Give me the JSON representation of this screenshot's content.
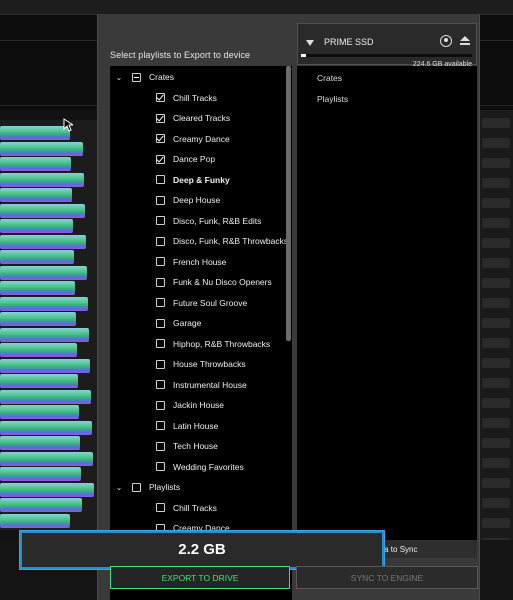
{
  "dialog": {
    "title": "Select playlists to Export to device"
  },
  "device": {
    "name": "PRIME SSD",
    "available": "224.6 GB available",
    "usage_fraction": 0.03
  },
  "tree": [
    {
      "indent": 0,
      "chevron": "v",
      "check": "partial",
      "label": "Crates",
      "bold": false
    },
    {
      "indent": 1,
      "check": "checked",
      "label": "Chill Tracks"
    },
    {
      "indent": 1,
      "check": "checked",
      "label": "Cleared Tracks"
    },
    {
      "indent": 1,
      "check": "checked",
      "label": "Creamy Dance"
    },
    {
      "indent": 1,
      "check": "checked",
      "label": "Dance Pop"
    },
    {
      "indent": 1,
      "check": "unchecked",
      "label": "Deep & Funky",
      "bold": true
    },
    {
      "indent": 1,
      "check": "unchecked",
      "label": "Deep House"
    },
    {
      "indent": 1,
      "check": "unchecked",
      "label": "Disco, Funk, R&B Edits"
    },
    {
      "indent": 1,
      "check": "unchecked",
      "label": "Disco, Funk, R&B Throwbacks"
    },
    {
      "indent": 1,
      "check": "unchecked",
      "label": "French House"
    },
    {
      "indent": 1,
      "check": "unchecked",
      "label": "Funk & Nu Disco Openers"
    },
    {
      "indent": 1,
      "check": "unchecked",
      "label": "Future Soul Groove"
    },
    {
      "indent": 1,
      "check": "unchecked",
      "label": "Garage"
    },
    {
      "indent": 1,
      "check": "unchecked",
      "label": "Hiphop, R&B Throwbacks"
    },
    {
      "indent": 1,
      "check": "unchecked",
      "label": "House Throwbacks"
    },
    {
      "indent": 1,
      "check": "unchecked",
      "label": "Instrumental House"
    },
    {
      "indent": 1,
      "check": "unchecked",
      "label": "Jackin House"
    },
    {
      "indent": 1,
      "check": "unchecked",
      "label": "Latin House"
    },
    {
      "indent": 1,
      "check": "unchecked",
      "label": "Tech House"
    },
    {
      "indent": 1,
      "check": "unchecked",
      "label": "Wedding Favorites"
    },
    {
      "indent": 0,
      "chevron": "v",
      "check": "unchecked",
      "label": "Playlists"
    },
    {
      "indent": 1,
      "check": "unchecked",
      "label": "Chill Tracks"
    },
    {
      "indent": 1,
      "check": "unchecked",
      "label": "Creamy Dance"
    }
  ],
  "right_panel": {
    "items": [
      "Crates",
      "Playlists"
    ],
    "footer_text": "data to Sync"
  },
  "size": "2.2 GB",
  "buttons": {
    "export": "EXPORT TO DRIVE",
    "sync": "SYNC TO ENGINE"
  },
  "colors": {
    "accent_green": "#3de37e",
    "accent_blue": "#2a8fc9"
  }
}
